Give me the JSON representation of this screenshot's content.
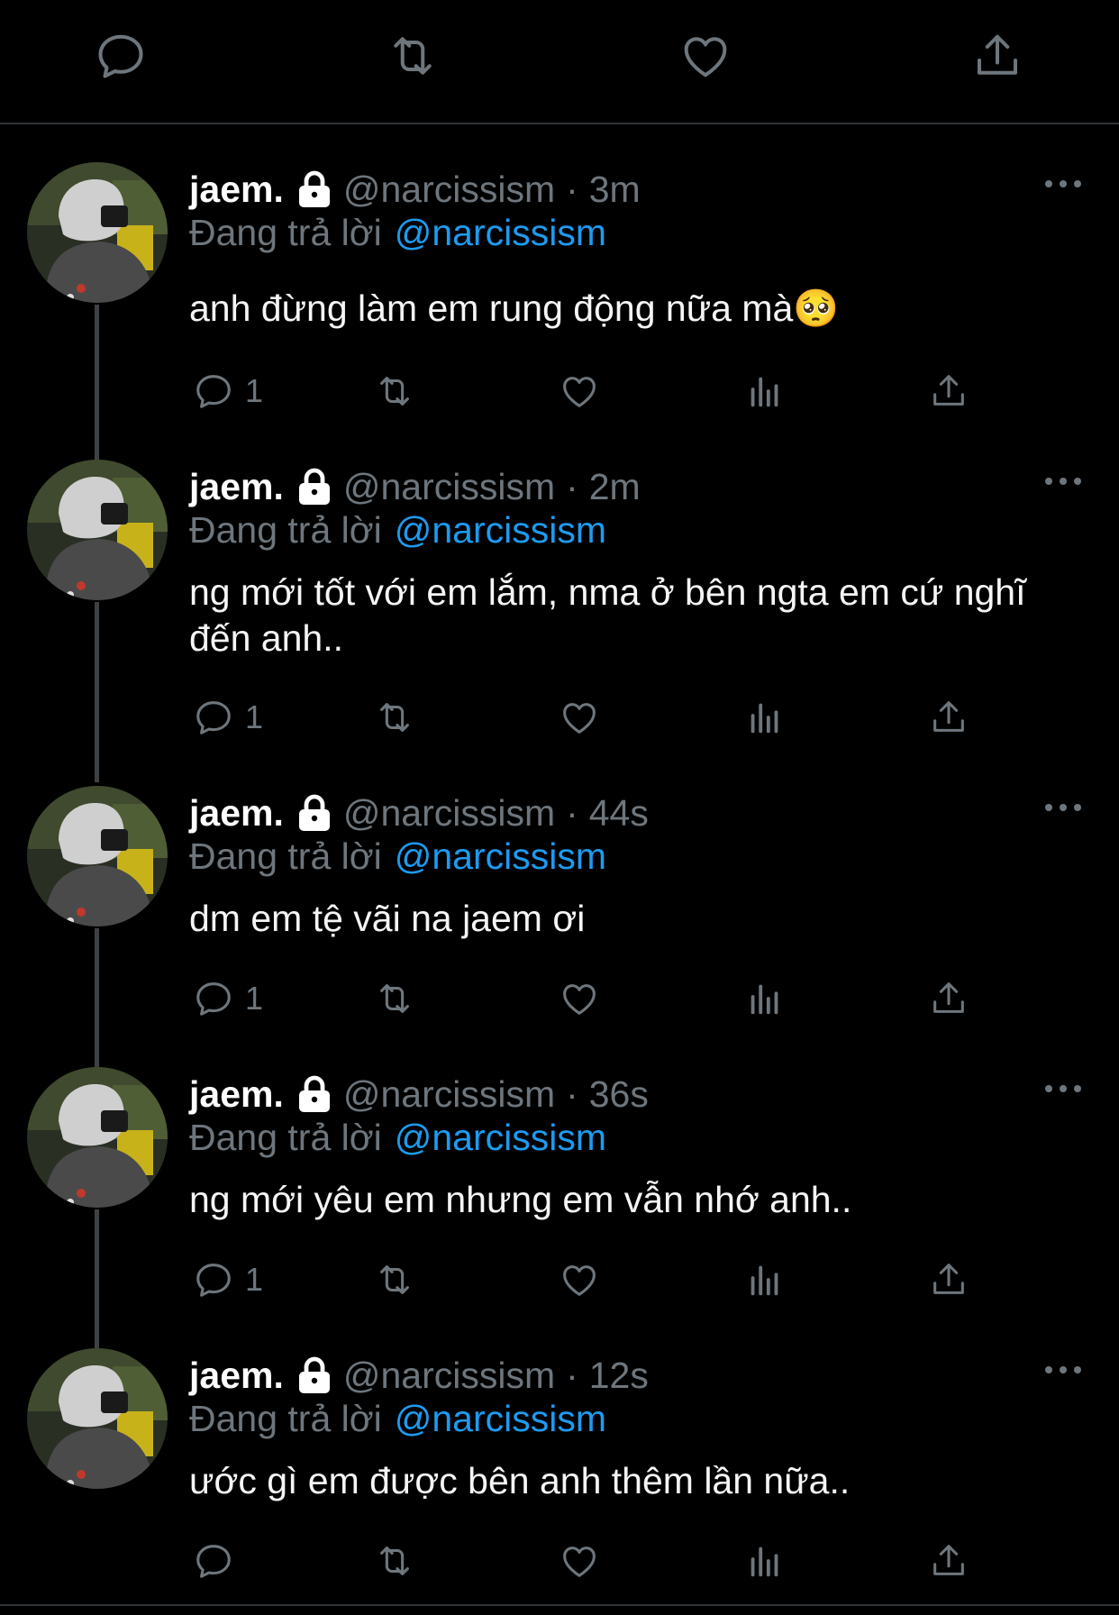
{
  "top_actions": [
    {
      "name": "reply-icon"
    },
    {
      "name": "retweet-icon"
    },
    {
      "name": "like-icon"
    },
    {
      "name": "share-icon"
    }
  ],
  "colors": {
    "background": "#000000",
    "accent": "#1d9bf0",
    "muted": "#6e767d",
    "text": "#e7e9ea"
  },
  "tweets": [
    {
      "display_name": "jaem.",
      "handle": "@narcissism",
      "separator": "·",
      "time": "3m",
      "reply_prefix": "Đang trả lời",
      "reply_to": "@narcissism",
      "text": "anh đừng làm em rung động nữa mà🥺",
      "reply_count": "1"
    },
    {
      "display_name": "jaem.",
      "handle": "@narcissism",
      "separator": "·",
      "time": "2m",
      "reply_prefix": "Đang trả lời",
      "reply_to": "@narcissism",
      "text": "ng mới tốt với em lắm, nma ở bên ngta em cứ nghĩ đến anh..",
      "reply_count": "1"
    },
    {
      "display_name": "jaem.",
      "handle": "@narcissism",
      "separator": "·",
      "time": "44s",
      "reply_prefix": "Đang trả lời",
      "reply_to": "@narcissism",
      "text": "dm em tệ vãi na jaem ơi",
      "reply_count": "1"
    },
    {
      "display_name": "jaem.",
      "handle": "@narcissism",
      "separator": "·",
      "time": "36s",
      "reply_prefix": "Đang trả lời",
      "reply_to": "@narcissism",
      "text": "ng mới yêu em nhưng em vẫn nhớ anh..",
      "reply_count": "1"
    },
    {
      "display_name": "jaem.",
      "handle": "@narcissism",
      "separator": "·",
      "time": "12s",
      "reply_prefix": "Đang trả lời",
      "reply_to": "@narcissism",
      "text": "ước gì em được bên anh thêm lần nữa..",
      "reply_count": ""
    }
  ]
}
